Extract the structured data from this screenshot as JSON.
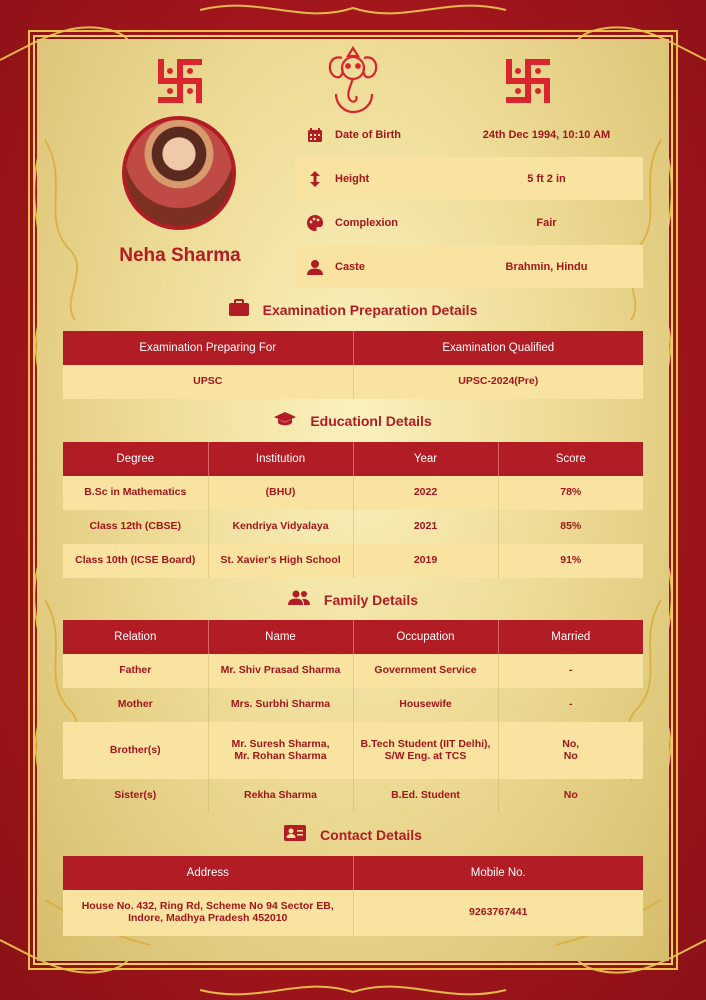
{
  "profile": {
    "name": "Neha Sharma"
  },
  "personal": [
    {
      "label": "Date of Birth",
      "value": "24th Dec 1994, 10:10 AM",
      "icon": "calendar-icon"
    },
    {
      "label": "Height",
      "value": "5 ft 2 in",
      "icon": "height-arrows-icon"
    },
    {
      "label": "Complexion",
      "value": "Fair",
      "icon": "palette-icon"
    },
    {
      "label": "Caste",
      "value": "Brahmin, Hindu",
      "icon": "person-icon"
    }
  ],
  "exam": {
    "title": "Examination Preparation Details",
    "headers": [
      "Examination Preparing For",
      "Examination Qualified"
    ],
    "rows": [
      [
        "UPSC",
        "UPSC-2024(Pre)"
      ]
    ]
  },
  "education": {
    "title": "Educationl Details",
    "headers": [
      "Degree",
      "Institution",
      "Year",
      "Score"
    ],
    "rows": [
      [
        "B.Sc in Mathematics",
        "(BHU)",
        "2022",
        "78%"
      ],
      [
        "Class 12th (CBSE)",
        "Kendriya Vidyalaya",
        "2021",
        "85%"
      ],
      [
        "Class 10th (ICSE Board)",
        "St. Xavier's High School",
        "2019",
        "91%"
      ]
    ]
  },
  "family": {
    "title": "Family Details",
    "headers": [
      "Relation",
      "Name",
      "Occupation",
      "Married"
    ],
    "rows": [
      [
        "Father",
        "Mr. Shiv Prasad Sharma",
        "Government Service",
        "-"
      ],
      [
        "Mother",
        "Mrs. Surbhi Sharma",
        "Housewife",
        "-"
      ],
      [
        "Brother(s)",
        "Mr. Suresh Sharma,\nMr. Rohan Sharma",
        "B.Tech Student (IIT Delhi),\nS/W Eng. at TCS",
        "No,\nNo"
      ],
      [
        "Sister(s)",
        "Rekha Sharma",
        "B.Ed. Student",
        "No"
      ]
    ]
  },
  "contact": {
    "title": "Contact Details",
    "headers": [
      "Address",
      "Mobile No."
    ],
    "rows": [
      [
        "House No. 432, Ring Rd, Scheme No 94 Sector EB,\nIndore, Madhya Pradesh 452010",
        "9263767441"
      ]
    ]
  },
  "colors": {
    "maroon": "#b21c24",
    "gold": "#e8c04a",
    "cream": "#f8e3a1"
  }
}
